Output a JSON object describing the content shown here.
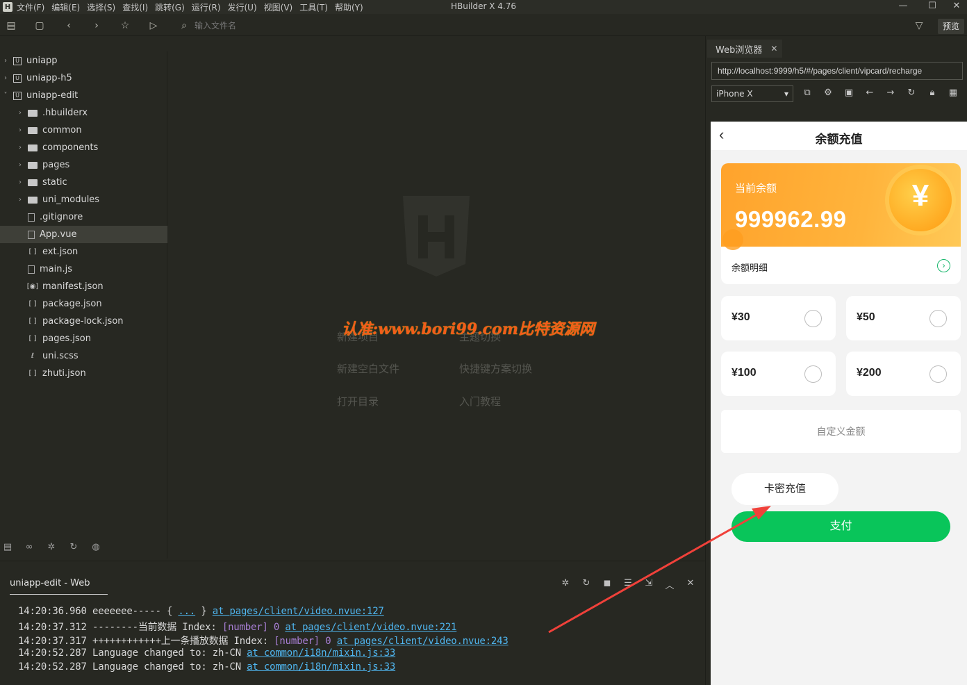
{
  "titlebar": {
    "title": "HBuilder X 4.76",
    "menus": [
      "文件(F)",
      "编辑(E)",
      "选择(S)",
      "查找(I)",
      "跳转(G)",
      "运行(R)",
      "发行(U)",
      "视图(V)",
      "工具(T)",
      "帮助(Y)"
    ]
  },
  "toolbar": {
    "search_placeholder": "输入文件名",
    "preview_label": "预览"
  },
  "sidebar": {
    "items": [
      {
        "label": "uniapp"
      },
      {
        "label": "uniapp-h5"
      },
      {
        "label": "uniapp-edit"
      },
      {
        "label": ".hbuilderx"
      },
      {
        "label": "common"
      },
      {
        "label": "components"
      },
      {
        "label": "pages"
      },
      {
        "label": "static"
      },
      {
        "label": "uni_modules"
      },
      {
        "label": ".gitignore"
      },
      {
        "label": "App.vue"
      },
      {
        "label": "ext.json"
      },
      {
        "label": "main.js"
      },
      {
        "label": "manifest.json"
      },
      {
        "label": "package.json"
      },
      {
        "label": "package-lock.json"
      },
      {
        "label": "pages.json"
      },
      {
        "label": "uni.scss"
      },
      {
        "label": "zhuti.json"
      }
    ],
    "selected": "App.vue"
  },
  "welcome": {
    "watermark": "认准:www.bori99.com比特资源网",
    "links": [
      "新建项目",
      "主题切换",
      "新建空白文件",
      "快捷键方案切换",
      "打开目录",
      "入门教程"
    ]
  },
  "console": {
    "tab_label": "uniapp-edit - Web",
    "lines": [
      {
        "time": "14:20:36.960",
        "text": "eeeeeee----- { ",
        "type": "",
        "mid": "",
        "link": "at pages/client/video.nvue:127",
        "ellipsis": "..."
      },
      {
        "time": "14:20:37.312",
        "text": "--------当前数据 Index: ",
        "type": "[number]",
        "mid": "0",
        "link": "at pages/client/video.nvue:221",
        "ellipsis": ""
      },
      {
        "time": "14:20:37.317",
        "text": "++++++++++++上一条播放数据 Index: ",
        "type": "[number]",
        "mid": "0",
        "link": "at pages/client/video.nvue:243",
        "ellipsis": ""
      },
      {
        "time": "14:20:52.287",
        "text": "Language changed to: zh-CN ",
        "type": "",
        "mid": "",
        "link": "at common/i18n/mixin.js:33",
        "ellipsis": ""
      },
      {
        "time": "14:20:52.287",
        "text": "Language changed to: zh-CN ",
        "type": "",
        "mid": "",
        "link": "at common/i18n/mixin.js:33",
        "ellipsis": ""
      }
    ]
  },
  "browser": {
    "tab_label": "Web浏览器",
    "url": "http://localhost:9999/h5/#/pages/client/vipcard/recharge",
    "device": "iPhone X"
  },
  "phone": {
    "nav_title": "余额充值",
    "balance_label": "当前余额",
    "balance_value": "999962.99",
    "coin_symbol": "¥",
    "detail_label": "余额明细",
    "amounts": [
      "¥30",
      "¥50",
      "¥100",
      "¥200"
    ],
    "custom_amount": "自定义金额",
    "card_recharge": "卡密充值",
    "pay": "支付"
  },
  "colors": {
    "accent_green": "#09c55a",
    "balance_orange": "#ffa32c",
    "annotation_red": "#f0413a"
  }
}
